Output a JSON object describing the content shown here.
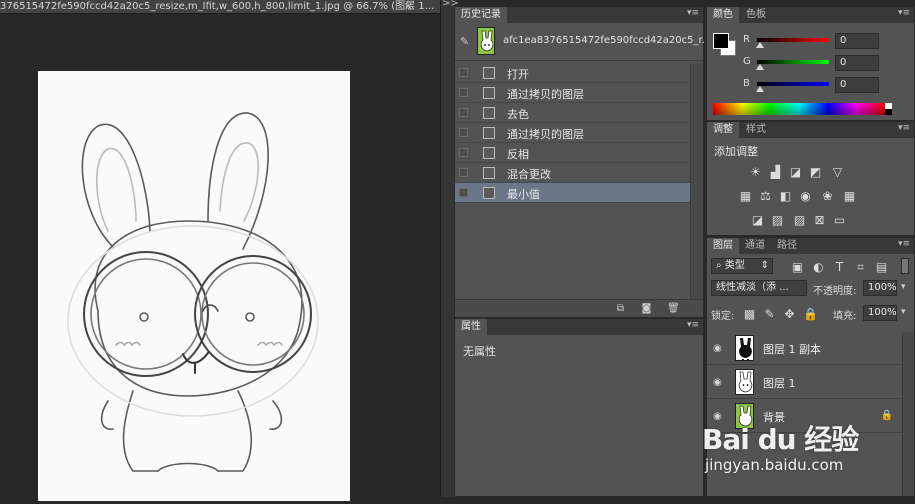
{
  "document": {
    "tab_title": "376515472fe590fccd42a20c5_resize,m_lfit,w_600,h_800,limit_1.jpg @ 66.7% (图层 1...",
    "close_glyph": "×",
    "collapse_glyph": ">>"
  },
  "history": {
    "tab_label": "历史记录",
    "snapshot_name": "afc1ea8376515472fe590fccd42a20c5_r...",
    "steps": [
      {
        "label": "打开",
        "selected": false
      },
      {
        "label": "通过拷贝的图层",
        "selected": false
      },
      {
        "label": "去色",
        "selected": false
      },
      {
        "label": "通过拷贝的图层",
        "selected": false
      },
      {
        "label": "反相",
        "selected": false
      },
      {
        "label": "混合更改",
        "selected": false
      },
      {
        "label": "最小值",
        "selected": true
      }
    ],
    "footer_icons": [
      "new-document-from-state-icon",
      "camera-icon",
      "trash-icon"
    ]
  },
  "properties": {
    "tab_label": "属性",
    "empty_text": "无属性"
  },
  "color": {
    "tabs": [
      "颜色",
      "色板"
    ],
    "fg": "#000000",
    "bg": "#ffffff",
    "channels": [
      {
        "label": "R",
        "value": "0",
        "track": "linear-gradient(to right,#000,#f00)"
      },
      {
        "label": "G",
        "value": "0",
        "track": "linear-gradient(to right,#000,#0f0)"
      },
      {
        "label": "B",
        "value": "0",
        "track": "linear-gradient(to right,#000,#00f)"
      }
    ]
  },
  "adjustments": {
    "tabs": [
      "调整",
      "样式"
    ],
    "heading": "添加调整",
    "icons": [
      "brightness-icon",
      "levels-icon",
      "curves-icon",
      "exposure-icon",
      "vibrance-icon",
      "hue-saturation-icon",
      "color-balance-icon",
      "black-white-icon",
      "photo-filter-icon",
      "channel-mixer-icon",
      "color-lookup-icon",
      "invert-icon",
      "posterize-icon",
      "threshold-icon",
      "selective-color-icon",
      "gradient-map-icon"
    ]
  },
  "layers": {
    "tabs": [
      "图层",
      "通道",
      "路径"
    ],
    "filter_kind": "类型",
    "blend_mode": "线性减淡（添 ...",
    "opacity_label": "不透明度:",
    "opacity_value": "100%",
    "lock_label": "锁定:",
    "fill_label": "填充:",
    "fill_value": "100%",
    "rows": [
      {
        "name": "图层 1 副本",
        "selected": true,
        "thumb": "inverted",
        "locked": false
      },
      {
        "name": "图层 1",
        "selected": false,
        "thumb": "normal",
        "locked": false
      },
      {
        "name": "背景",
        "selected": false,
        "thumb": "green",
        "locked": true
      }
    ]
  },
  "watermark": {
    "brand": "Bai du 经验",
    "url": "jingyan.baidu.com"
  }
}
